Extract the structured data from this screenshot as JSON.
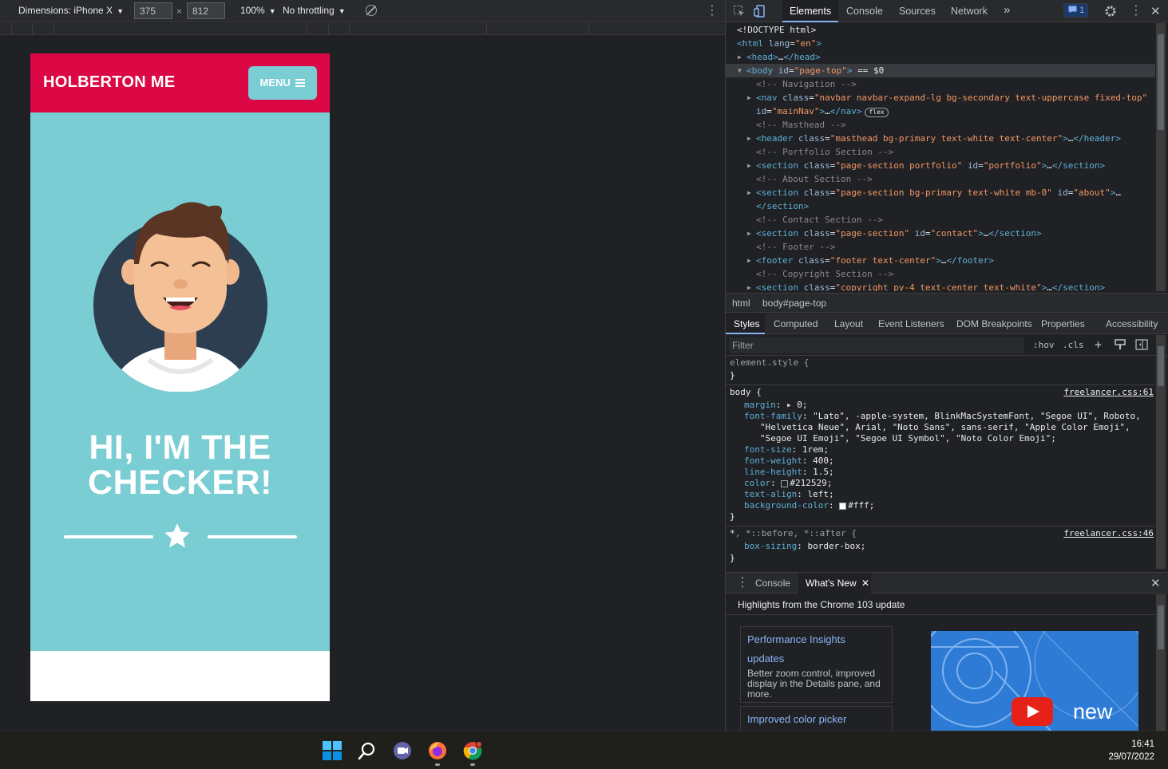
{
  "device_toolbar": {
    "dimensions_label": "Dimensions: iPhone X",
    "width_value": "375",
    "height_value": "812",
    "zoom": "100%",
    "throttling": "No throttling"
  },
  "page": {
    "brand": "HOLBERTON ME",
    "menu_label": "MENU",
    "hero_line1": "HI, I'M THE",
    "hero_line2": "CHECKER!",
    "colors": {
      "navbar": "#dc0845",
      "masthead": "#7acdd3"
    }
  },
  "devtools": {
    "tabs": [
      "Elements",
      "Console",
      "Sources",
      "Network"
    ],
    "more_tabs": "»",
    "issues_count": "1",
    "dom_lines": [
      {
        "parts": [
          [
            "plain",
            "<!DOCTYPE html>"
          ]
        ]
      },
      {
        "parts": [
          [
            "tag",
            "<html "
          ],
          [
            "attr",
            "lang"
          ],
          [
            "plain",
            "="
          ],
          [
            "val",
            "\"en\""
          ],
          [
            "tag",
            ">"
          ]
        ]
      },
      {
        "parts": [
          [
            "tag",
            "<head>"
          ],
          [
            "plain",
            "…"
          ],
          [
            "tag",
            "</head>"
          ]
        ]
      },
      {
        "parts": [
          [
            "tag",
            "<body "
          ],
          [
            "attr",
            "id"
          ],
          [
            "plain",
            "="
          ],
          [
            "val",
            "\"page-top\""
          ],
          [
            "tag",
            ">"
          ],
          [
            "plain",
            " == $0"
          ]
        ]
      },
      {
        "parts": [
          [
            "comment",
            "<!-- Navigation -->"
          ]
        ]
      },
      {
        "parts": [
          [
            "tag",
            "<nav "
          ],
          [
            "attr",
            "class"
          ],
          [
            "plain",
            "="
          ],
          [
            "val",
            "\"navbar navbar-expand-lg bg-secondary text-uppercase fixed-top\""
          ]
        ]
      },
      {
        "parts": [
          [
            "attr",
            "id"
          ],
          [
            "plain",
            "="
          ],
          [
            "val",
            "\"mainNav\""
          ],
          [
            "tag",
            ">"
          ],
          [
            "plain",
            "…"
          ],
          [
            "tag",
            "</nav>"
          ]
        ]
      },
      {
        "parts": [
          [
            "comment",
            "<!-- Masthead -->"
          ]
        ]
      },
      {
        "parts": [
          [
            "tag",
            "<header "
          ],
          [
            "attr",
            "class"
          ],
          [
            "plain",
            "="
          ],
          [
            "val",
            "\"masthead bg-primary text-white text-center\""
          ],
          [
            "tag",
            ">"
          ],
          [
            "plain",
            "…"
          ],
          [
            "tag",
            "</header>"
          ]
        ]
      },
      {
        "parts": [
          [
            "comment",
            "<!-- Portfolio Section -->"
          ]
        ]
      },
      {
        "parts": [
          [
            "tag",
            "<section "
          ],
          [
            "attr",
            "class"
          ],
          [
            "plain",
            "="
          ],
          [
            "val",
            "\"page-section portfolio\""
          ],
          [
            "plain",
            " "
          ],
          [
            "attr",
            "id"
          ],
          [
            "plain",
            "="
          ],
          [
            "val",
            "\"portfolio\""
          ],
          [
            "tag",
            ">"
          ],
          [
            "plain",
            "…"
          ],
          [
            "tag",
            "</section>"
          ]
        ]
      },
      {
        "parts": [
          [
            "comment",
            "<!-- About Section -->"
          ]
        ]
      },
      {
        "parts": [
          [
            "tag",
            "<section "
          ],
          [
            "attr",
            "class"
          ],
          [
            "plain",
            "="
          ],
          [
            "val",
            "\"page-section bg-primary text-white mb-0\""
          ],
          [
            "plain",
            " "
          ],
          [
            "attr",
            "id"
          ],
          [
            "plain",
            "="
          ],
          [
            "val",
            "\"about\""
          ],
          [
            "tag",
            ">"
          ],
          [
            "plain",
            "…"
          ]
        ]
      },
      {
        "parts": [
          [
            "tag",
            "</section>"
          ]
        ]
      },
      {
        "parts": [
          [
            "comment",
            "<!-- Contact Section -->"
          ]
        ]
      },
      {
        "parts": [
          [
            "tag",
            "<section "
          ],
          [
            "attr",
            "class"
          ],
          [
            "plain",
            "="
          ],
          [
            "val",
            "\"page-section\""
          ],
          [
            "plain",
            " "
          ],
          [
            "attr",
            "id"
          ],
          [
            "plain",
            "="
          ],
          [
            "val",
            "\"contact\""
          ],
          [
            "tag",
            ">"
          ],
          [
            "plain",
            "…"
          ],
          [
            "tag",
            "</section>"
          ]
        ]
      },
      {
        "parts": [
          [
            "comment",
            "<!-- Footer -->"
          ]
        ]
      },
      {
        "parts": [
          [
            "tag",
            "<footer "
          ],
          [
            "attr",
            "class"
          ],
          [
            "plain",
            "="
          ],
          [
            "val",
            "\"footer text-center\""
          ],
          [
            "tag",
            ">"
          ],
          [
            "plain",
            "…"
          ],
          [
            "tag",
            "</footer>"
          ]
        ]
      },
      {
        "parts": [
          [
            "comment",
            "<!-- Copyright Section -->"
          ]
        ]
      },
      {
        "parts": [
          [
            "tag",
            "<section "
          ],
          [
            "attr",
            "class"
          ],
          [
            "plain",
            "="
          ],
          [
            "val",
            "\"copyright py-4 text-center text-white\""
          ],
          [
            "tag",
            ">"
          ],
          [
            "plain",
            "…"
          ],
          [
            "tag",
            "</section>"
          ]
        ]
      }
    ],
    "flex_badge": "flex",
    "breadcrumb": [
      "html",
      "body#page-top"
    ],
    "style_tabs": [
      "Styles",
      "Computed",
      "Layout",
      "Event Listeners",
      "DOM Breakpoints",
      "Properties",
      "Accessibility"
    ],
    "filter_placeholder": "Filter",
    "filter_options": [
      ":hov",
      ".cls",
      "+"
    ],
    "element_style": "element.style {",
    "close_brace": "}",
    "body_rule": {
      "selector": "body {",
      "source": "freelancer.css:61",
      "declarations": [
        {
          "prop": "margin",
          "value": "▸ 0;"
        },
        {
          "prop": "font-family",
          "value": "\"Lato\", -apple-system, BlinkMacSystemFont, \"Segoe UI\", Roboto,"
        },
        {
          "prop": "",
          "value": "\"Helvetica Neue\", Arial, \"Noto Sans\", sans-serif, \"Apple Color Emoji\","
        },
        {
          "prop": "",
          "value": "\"Segoe UI Emoji\", \"Segoe UI Symbol\", \"Noto Color Emoji\";"
        },
        {
          "prop": "font-size",
          "value": "1rem;"
        },
        {
          "prop": "font-weight",
          "value": "400;"
        },
        {
          "prop": "line-height",
          "value": "1.5;"
        },
        {
          "prop": "color",
          "value": "#212529;"
        },
        {
          "prop": "text-align",
          "value": "left;"
        },
        {
          "prop": "background-color",
          "value": "#fff;"
        }
      ]
    },
    "universal_rule": {
      "selector_main": "*",
      "selector_rest": ", *::before, *::after {",
      "source": "freelancer.css:46",
      "prop": "box-sizing",
      "value": "border-box;"
    },
    "drawer_tabs": [
      "Console",
      "What's New"
    ],
    "whats_new_heading": "Highlights from the Chrome 103 update",
    "cards": [
      {
        "title1": "Performance Insights",
        "title2": "updates",
        "desc": "Better zoom control, improved display in the Details pane, and more."
      },
      {
        "title1": "Improved color picker",
        "title2": "",
        "desc": ""
      }
    ],
    "video_text": "new"
  },
  "taskbar": {
    "time": "16:41",
    "date": "29/07/2022"
  }
}
